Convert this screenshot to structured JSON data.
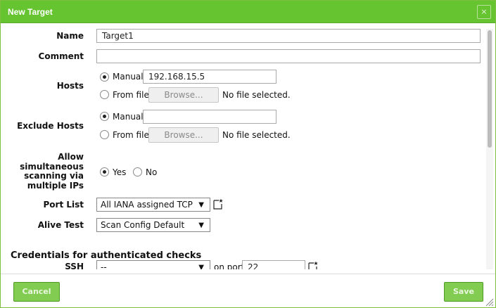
{
  "dialog": {
    "title": "New Target",
    "close_glyph": "×"
  },
  "form": {
    "name": {
      "label": "Name",
      "value": "Target1"
    },
    "comment": {
      "label": "Comment",
      "value": ""
    },
    "hosts": {
      "label": "Hosts",
      "manual_label": "Manual",
      "manual_value": "192.168.15.5",
      "manual_checked": true,
      "from_file_label": "From file",
      "browse_label": "Browse...",
      "file_status": "No file selected."
    },
    "exclude_hosts": {
      "label": "Exclude Hosts",
      "manual_label": "Manual",
      "manual_value": "",
      "manual_checked": true,
      "from_file_label": "From file",
      "browse_label": "Browse...",
      "file_status": "No file selected."
    },
    "simultaneous": {
      "label_lines": [
        "Allow",
        "simultaneous",
        "scanning via",
        "multiple IPs"
      ],
      "yes_label": "Yes",
      "no_label": "No",
      "selected": "Yes"
    },
    "port_list": {
      "label": "Port List",
      "value": "All IANA assigned TCP"
    },
    "alive_test": {
      "label": "Alive Test",
      "value": "Scan Config Default"
    },
    "credentials": {
      "section_title": "Credentials for authenticated checks",
      "ssh": {
        "label": "SSH",
        "value": "--",
        "on_port_label": "on port",
        "port_value": "22"
      }
    }
  },
  "footer": {
    "cancel_label": "Cancel",
    "save_label": "Save"
  },
  "icons": {
    "dropdown": "▼",
    "new": "new-icon",
    "close": "close-icon",
    "resize": "resize-grip-icon"
  },
  "colors": {
    "titlebar": "#66c430",
    "button": "#82cc52",
    "button_border": "#4f9a22"
  }
}
